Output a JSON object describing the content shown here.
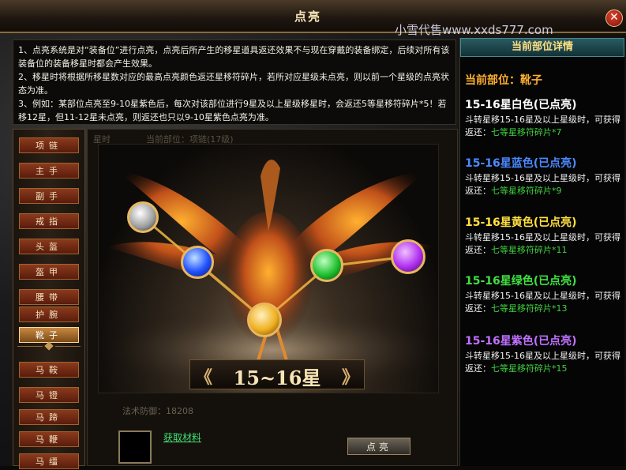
{
  "window": {
    "title": "点亮",
    "close_icon": "close-icon"
  },
  "watermark": "小雪代售www.xxds777.com",
  "description": [
    "1、点亮系统是对“装备位”进行点亮，点亮后所产生的移星道具返还效果不与现在穿戴的装备绑定，后续对所有该装备位的装备移星时都会产生效果。",
    "2、移星时将根据所移星数对应的最高点亮颜色返还星移符碎片，若所对应星级未点亮，则以前一个星级的点亮状态为准。",
    "3、例如：某部位点亮至9-10星紫色后，每次对该部位进行9星及以上星级移星时，会返还5等星移符碎片*5！若移12星，但11-12星未点亮，则返还也只以9-10星紫色点亮为准。"
  ],
  "slots": [
    {
      "label": "项链"
    },
    {
      "label": "主手"
    },
    {
      "label": "副手"
    },
    {
      "label": "戒指"
    },
    {
      "label": "头盔"
    },
    {
      "label": "盔甲"
    },
    {
      "label": "腰带"
    },
    {
      "label": "护腕"
    },
    {
      "label": "靴子"
    },
    {
      "label": "马鞍"
    },
    {
      "label": "马镫"
    },
    {
      "label": "马蹄"
    },
    {
      "label": "马鞭"
    },
    {
      "label": "马缰"
    }
  ],
  "active_slot": "靴子",
  "ghost_text": {
    "left": "星时",
    "mid": "当前部位：项链(17级)",
    "bottom": "法术防御：18208"
  },
  "star_banner": {
    "left_arrow": "《",
    "label": "15~16星",
    "right_arrow": "》"
  },
  "orbs": [
    {
      "name": "white",
      "color": "#e8e8e8"
    },
    {
      "name": "blue",
      "color": "#3a70ff"
    },
    {
      "name": "yellow",
      "color": "#ffd040"
    },
    {
      "name": "green",
      "color": "#30d040"
    },
    {
      "name": "purple",
      "color": "#c040ff"
    }
  ],
  "material": {
    "link": "获取材料"
  },
  "light_button": "点亮",
  "panel": {
    "header": "当前部位详情",
    "current_part": "当前部位：靴子",
    "tiers": [
      {
        "title": "15-16星白色(已点亮)",
        "color": "#ffffff",
        "desc": "斗转星移15-16星及以上星级时，可获得返还：",
        "reward": "七等星移符碎片*7"
      },
      {
        "title": "15-16星蓝色(已点亮)",
        "color": "#4a8aff",
        "desc": "斗转星移15-16星及以上星级时，可获得返还：",
        "reward": "七等星移符碎片*9"
      },
      {
        "title": "15-16星黄色(已点亮)",
        "color": "#ffe040",
        "desc": "斗转星移15-16星及以上星级时，可获得返还：",
        "reward": "七等星移符碎片*11"
      },
      {
        "title": "15-16星绿色(已点亮)",
        "color": "#40e040",
        "desc": "斗转星移15-16星及以上星级时，可获得返还：",
        "reward": "七等星移符碎片*13"
      },
      {
        "title": "15-16星紫色(已点亮)",
        "color": "#c070ff",
        "desc": "斗转星移15-16星及以上星级时，可获得返还：",
        "reward": "七等星移符碎片*15"
      }
    ]
  }
}
